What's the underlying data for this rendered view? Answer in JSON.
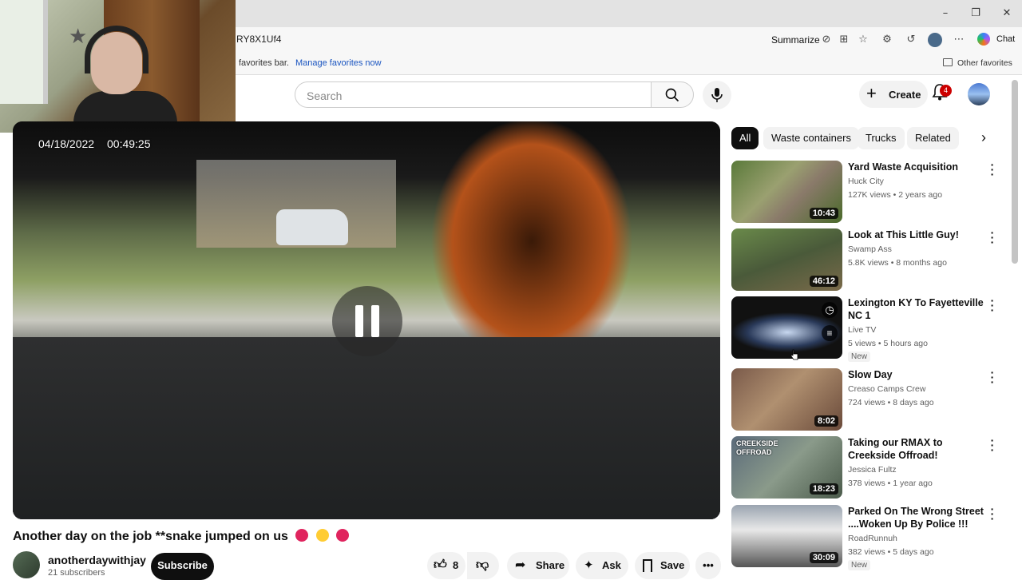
{
  "browser": {
    "url_fragment": "RY8X1Uf4",
    "summarize_label": "Summarize",
    "chat_label": "Chat",
    "favbar_text": "favorites bar.",
    "manage_favorites": "Manage favorites now",
    "other_favorites": "Other favorites"
  },
  "header": {
    "search_placeholder": "Search",
    "create_label": "Create",
    "notification_count": "4"
  },
  "video": {
    "date_stamp": "04/18/2022",
    "time_stamp": "00:49:25",
    "title": "Another day on the job **snake jumped on us"
  },
  "channel": {
    "name": "anotherdaywithjay",
    "subscribers": "21 subscribers",
    "subscribe_label": "Subscribe"
  },
  "actions": {
    "like_count": "8",
    "share_label": "Share",
    "ask_label": "Ask",
    "save_label": "Save"
  },
  "chips": [
    "All",
    "Waste containers",
    "Trucks",
    "Related"
  ],
  "recommendations": [
    {
      "title": "Yard Waste Acquisition",
      "channel": "Huck City",
      "meta": "127K views • 2 years ago",
      "duration": "10:43",
      "new": ""
    },
    {
      "title": "Look at This Little Guy!",
      "channel": "Swamp Ass",
      "meta": "5.8K views • 8 months ago",
      "duration": "46:12",
      "new": ""
    },
    {
      "title": "Lexington KY To Fayetteville NC 1",
      "channel": "Live TV",
      "meta": "5 views • 5 hours ago",
      "duration": "",
      "new": "New"
    },
    {
      "title": "Slow Day",
      "channel": "Creaso Camps Crew",
      "meta": "724 views • 8 days ago",
      "duration": "8:02",
      "new": ""
    },
    {
      "title": "Taking our RMAX to Creekside Offroad!",
      "channel": "Jessica Fultz",
      "meta": "378 views • 1 year ago",
      "duration": "18:23",
      "new": ""
    },
    {
      "title": "Parked On The Wrong Street ....Woken Up By Police !!!",
      "channel": "RoadRunnuh",
      "meta": "382 views • 5 days ago",
      "duration": "30:09",
      "new": "New"
    }
  ],
  "thumb_overlay_text": "CREEKSIDE OFFROAD"
}
